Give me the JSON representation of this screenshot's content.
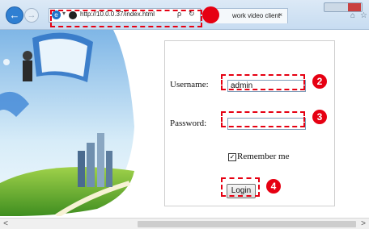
{
  "browser": {
    "url": "http://10.0.0.37/index.html",
    "search_glyph": "ρ",
    "dropdown_glyph": "▾",
    "refresh_glyph": "↻",
    "tab_title": "work video client",
    "tab_close": "×",
    "back_glyph": "←",
    "forward_glyph": "→",
    "home_glyph": "⌂",
    "favorites_glyph": "☆",
    "ie_glyph": "e"
  },
  "login": {
    "username_label": "Username:",
    "username_value": "admin",
    "password_label": "Password:",
    "password_value": "",
    "remember_checked_glyph": "✓",
    "remember_label": "Remember me",
    "login_button": "Login"
  },
  "annotations": {
    "n2": "2",
    "n3": "3",
    "n4": "4"
  },
  "scrollbar": {
    "left_arrow": "<",
    "right_arrow": ">"
  },
  "colors": {
    "annotation": "#e60012",
    "browser_chrome": "#c7dcf1"
  },
  "icons": {
    "back": "back-arrow-icon",
    "forward": "forward-arrow-icon",
    "ie": "ie-logo-icon",
    "search": "search-icon",
    "refresh": "refresh-icon",
    "home": "home-icon",
    "favorites": "star-icon"
  }
}
